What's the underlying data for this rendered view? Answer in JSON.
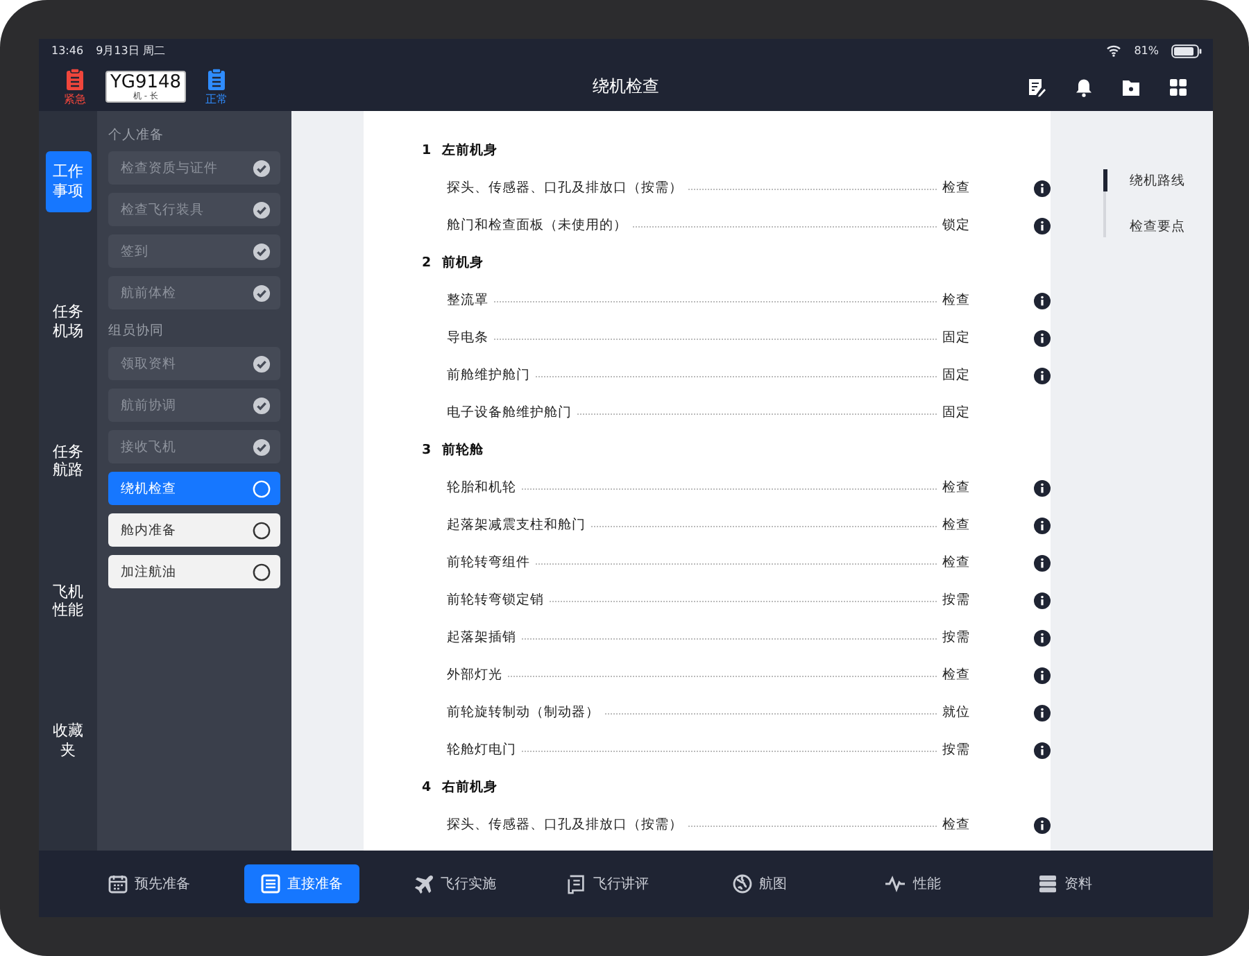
{
  "status_bar": {
    "time": "13:46",
    "date": "9月13日 周二",
    "battery": "81%"
  },
  "header": {
    "badges": [
      {
        "kind": "alert",
        "label": "紧急"
      },
      {
        "kind": "plate",
        "number": "YG9148",
        "role": "机 - 长"
      },
      {
        "kind": "normal",
        "label": "正常"
      }
    ],
    "title": "绕机检查"
  },
  "rail": [
    {
      "label": "工作事项",
      "selected": true
    },
    {
      "label": "任务机场",
      "selected": false
    },
    {
      "label": "任务航路",
      "selected": false
    },
    {
      "label": "飞机性能",
      "selected": false
    },
    {
      "label": "收藏夹",
      "selected": false
    }
  ],
  "sidebar": {
    "groups": [
      {
        "title": "个人准备",
        "items": [
          {
            "label": "检查资质与证件",
            "done": true,
            "selected": false
          },
          {
            "label": "检查飞行装具",
            "done": true,
            "selected": false
          },
          {
            "label": "签到",
            "done": true,
            "selected": false
          },
          {
            "label": "航前体检",
            "done": true,
            "selected": false
          }
        ]
      },
      {
        "title": "组员协同",
        "items": [
          {
            "label": "领取资料",
            "done": true,
            "selected": false
          },
          {
            "label": "航前协调",
            "done": true,
            "selected": false
          },
          {
            "label": "接收飞机",
            "done": true,
            "selected": false
          },
          {
            "label": "绕机检查",
            "done": false,
            "selected": true
          },
          {
            "label": "舱内准备",
            "done": false,
            "selected": false
          },
          {
            "label": "加注航油",
            "done": false,
            "selected": false
          }
        ]
      }
    ]
  },
  "checklist": {
    "sections": [
      {
        "number": "1",
        "title": "左前机身",
        "items": [
          {
            "label": "探头、传感器、口孔及排放口（按需）",
            "action": "检查",
            "info": true
          },
          {
            "label": "舱门和检查面板（未使用的）",
            "action": "锁定",
            "info": true
          }
        ]
      },
      {
        "number": "2",
        "title": "前机身",
        "items": [
          {
            "label": "整流罩",
            "action": "检查",
            "info": true
          },
          {
            "label": "导电条",
            "action": "固定",
            "info": true
          },
          {
            "label": "前舱维护舱门",
            "action": "固定",
            "info": true
          },
          {
            "label": "电子设备舱维护舱门",
            "action": "固定",
            "info": false
          }
        ]
      },
      {
        "number": "3",
        "title": "前轮舱",
        "items": [
          {
            "label": "轮胎和机轮",
            "action": "检查",
            "info": true
          },
          {
            "label": "起落架减震支柱和舱门",
            "action": "检查",
            "info": true
          },
          {
            "label": "前轮转弯组件",
            "action": "检查",
            "info": true
          },
          {
            "label": "前轮转弯锁定销",
            "action": "按需",
            "info": true
          },
          {
            "label": "起落架插销",
            "action": "按需",
            "info": true
          },
          {
            "label": "外部灯光",
            "action": "检查",
            "info": true
          },
          {
            "label": "前轮旋转制动（制动器）",
            "action": "就位",
            "info": true
          },
          {
            "label": "轮舱灯电门",
            "action": "按需",
            "info": true
          }
        ]
      },
      {
        "number": "4",
        "title": "右前机身",
        "items": [
          {
            "label": "探头、传感器、口孔及排放口（按需）",
            "action": "检查",
            "info": true
          }
        ]
      }
    ]
  },
  "outline": [
    {
      "label": "绕机路线",
      "selected": true
    },
    {
      "label": "检查要点",
      "selected": false
    }
  ],
  "tabs": [
    {
      "label": "预先准备",
      "selected": false
    },
    {
      "label": "直接准备",
      "selected": true
    },
    {
      "label": "飞行实施",
      "selected": false
    },
    {
      "label": "飞行讲评",
      "selected": false
    },
    {
      "label": "航图",
      "selected": false
    },
    {
      "label": "性能",
      "selected": false
    },
    {
      "label": "资料",
      "selected": false
    }
  ]
}
